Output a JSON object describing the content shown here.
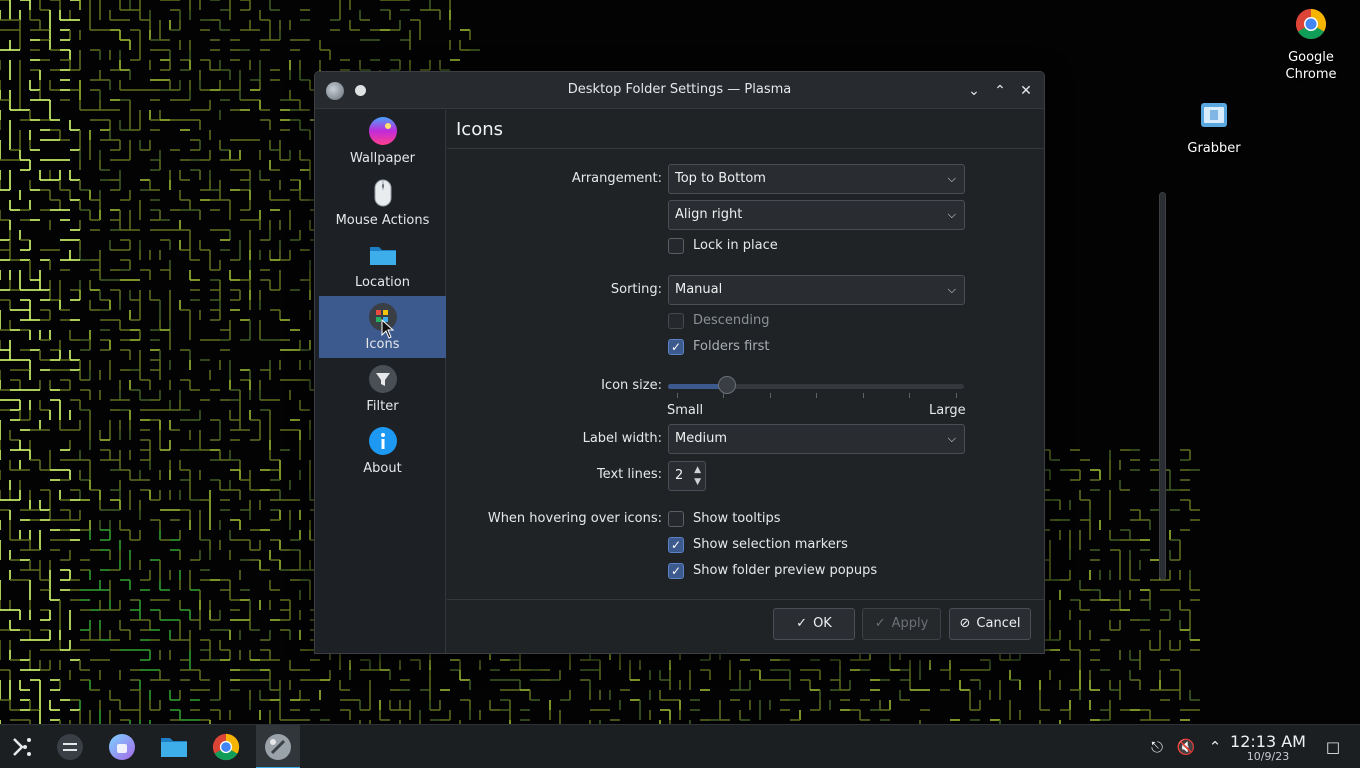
{
  "desktop": {
    "icons": [
      {
        "label_line1": "Google",
        "label_line2": "Chrome",
        "icon": "chrome-icon"
      },
      {
        "label_line1": "Grabber",
        "label_line2": "",
        "icon": "grabber-icon"
      }
    ]
  },
  "dialog": {
    "title": "Desktop Folder Settings — Plasma",
    "window_buttons": {
      "minimize": "⌄",
      "maximize": "⌃",
      "close": "✕"
    },
    "sidebar": {
      "items": [
        {
          "label": "Wallpaper",
          "icon": "wallpaper-icon"
        },
        {
          "label": "Mouse Actions",
          "icon": "mouse-icon"
        },
        {
          "label": "Location",
          "icon": "folder-icon"
        },
        {
          "label": "Icons",
          "icon": "icons-icon",
          "selected": true
        },
        {
          "label": "Filter",
          "icon": "filter-icon"
        },
        {
          "label": "About",
          "icon": "info-icon"
        }
      ]
    },
    "page": {
      "heading": "Icons",
      "arrangement": {
        "label": "Arrangement:",
        "value": "Top to Bottom"
      },
      "alignment": {
        "value": "Align right"
      },
      "lock_in_place": {
        "label": "Lock in place",
        "checked": false
      },
      "sorting": {
        "label": "Sorting:",
        "value": "Manual"
      },
      "descending": {
        "label": "Descending",
        "checked": false,
        "enabled": false
      },
      "folders_first": {
        "label": "Folders first",
        "checked": true
      },
      "icon_size": {
        "label": "Icon size:",
        "min_label": "Small",
        "max_label": "Large",
        "level": 0.2
      },
      "label_width": {
        "label": "Label width:",
        "value": "Medium"
      },
      "text_lines": {
        "label": "Text lines:",
        "value": "2"
      },
      "hover": {
        "label": "When hovering over icons:",
        "show_tooltips": {
          "label": "Show tooltips",
          "checked": false
        },
        "show_selection_markers": {
          "label": "Show selection markers",
          "checked": true
        },
        "show_folder_preview_popups": {
          "label": "Show folder preview popups",
          "checked": true
        }
      }
    },
    "buttons": {
      "ok": "OK",
      "apply": "Apply",
      "cancel": "Cancel"
    }
  },
  "taskbar": {
    "apps": [
      "app-launcher-icon",
      "overview-icon",
      "discover-icon",
      "file-manager-icon",
      "chrome-icon",
      "settings-icon"
    ],
    "time": "12:13 AM",
    "date": "10/9/23"
  },
  "colors": {
    "accent": "#3d5a8e",
    "highlight": "#3daee9",
    "maze_bright": "#d7ff6e",
    "maze_green": "#2f9a2f"
  }
}
